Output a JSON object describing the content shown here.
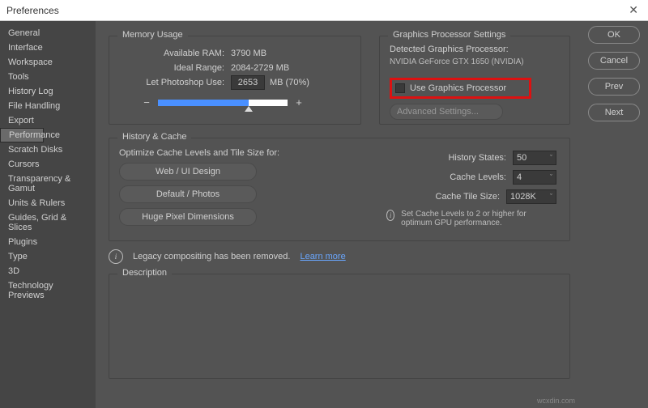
{
  "titlebar": {
    "title": "Preferences",
    "close": "✕"
  },
  "sidebar": {
    "items": [
      "General",
      "Interface",
      "Workspace",
      "Tools",
      "History Log",
      "File Handling",
      "Export",
      "Performance",
      "Scratch Disks",
      "Cursors",
      "Transparency & Gamut",
      "Units & Rulers",
      "Guides, Grid & Slices",
      "Plugins",
      "Type",
      "3D",
      "Technology Previews"
    ],
    "selected_index": 7
  },
  "buttons": {
    "ok": "OK",
    "cancel": "Cancel",
    "prev": "Prev",
    "next": "Next"
  },
  "memory": {
    "panel_title": "Memory Usage",
    "available_label": "Available RAM:",
    "available_value": "3790 MB",
    "ideal_label": "Ideal Range:",
    "ideal_value": "2084-2729 MB",
    "let_label": "Let Photoshop Use:",
    "let_value": "2653",
    "let_unit": "MB (70%)",
    "minus": "−",
    "plus": "+",
    "slider_percent": 70
  },
  "gpu": {
    "panel_title": "Graphics Processor Settings",
    "detected_label": "Detected Graphics Processor:",
    "detected_value": "NVIDIA GeForce GTX 1650 (NVIDIA)",
    "use_label": "Use Graphics Processor",
    "advanced": "Advanced Settings..."
  },
  "history": {
    "panel_title": "History & Cache",
    "optimize_label": "Optimize Cache Levels and Tile Size for:",
    "btn_web": "Web / UI Design",
    "btn_default": "Default / Photos",
    "btn_huge": "Huge Pixel Dimensions",
    "states_label": "History States:",
    "states_value": "50",
    "levels_label": "Cache Levels:",
    "levels_value": "4",
    "tile_label": "Cache Tile Size:",
    "tile_value": "1028K",
    "tip": "Set Cache Levels to 2 or higher for optimum GPU performance."
  },
  "legacy": {
    "text": "Legacy compositing has been removed.",
    "link": "Learn more"
  },
  "description": {
    "panel_title": "Description"
  },
  "watermark": "wcxdin.com"
}
